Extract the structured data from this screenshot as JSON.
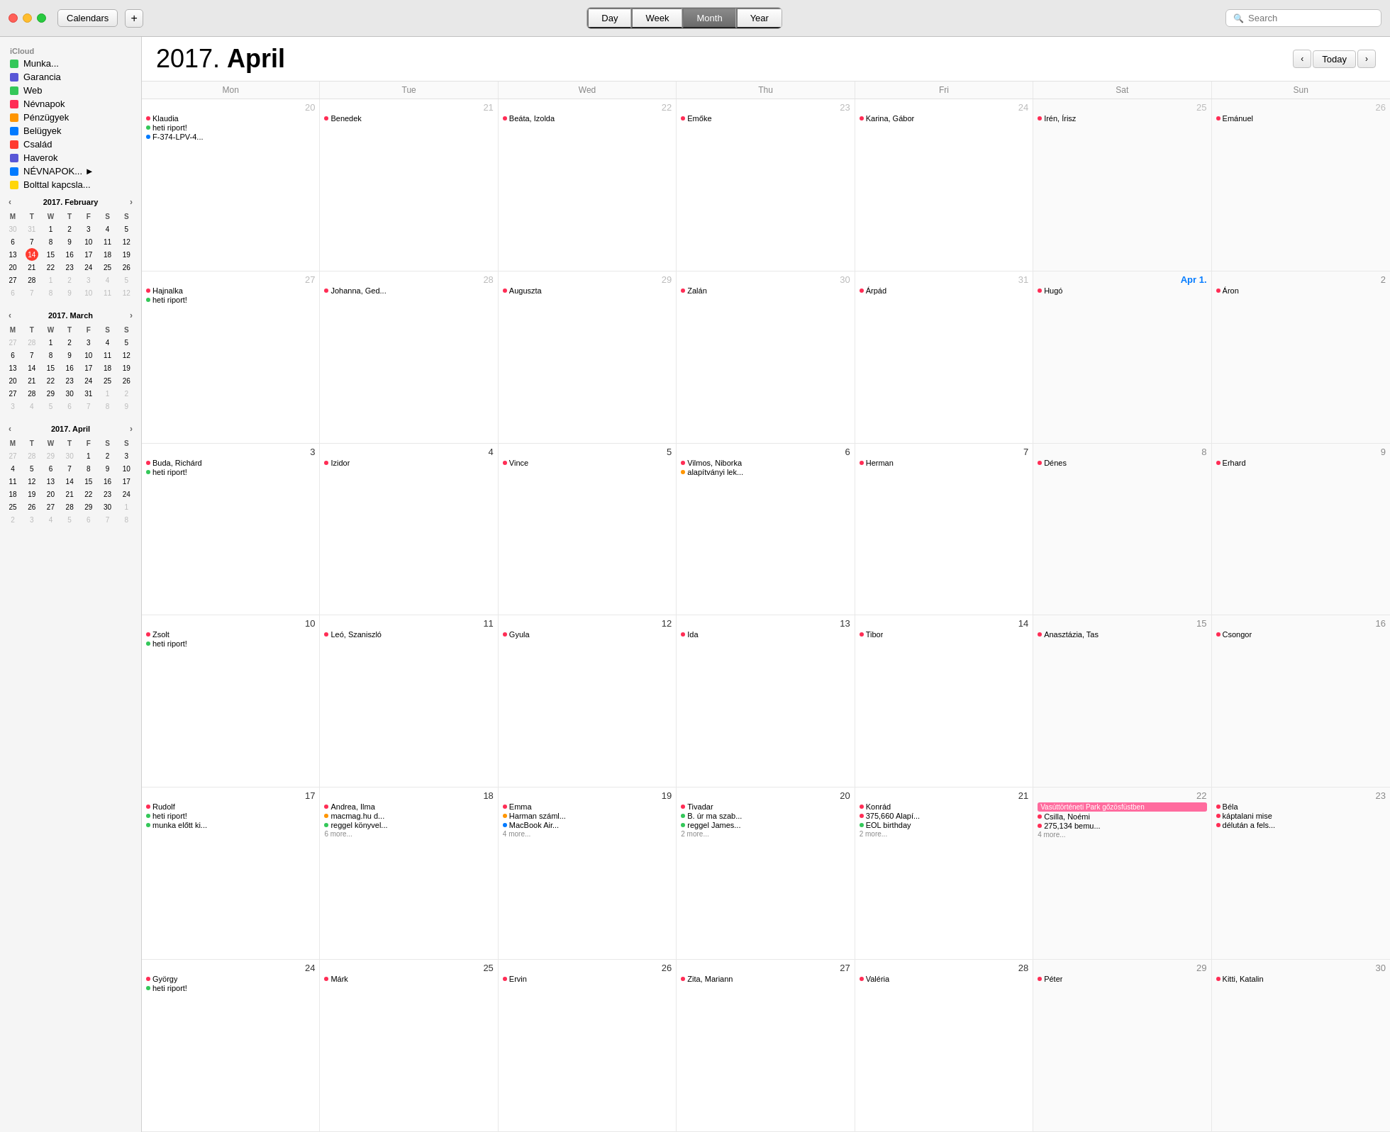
{
  "titlebar": {
    "calendars_label": "Calendars",
    "add_label": "+",
    "view_day": "Day",
    "view_week": "Week",
    "view_month": "Month",
    "view_year": "Year",
    "search_placeholder": "Search",
    "today_label": "Today"
  },
  "sidebar": {
    "section_label": "iCloud",
    "calendars": [
      {
        "name": "Munka...",
        "color": "#34c759",
        "checked": true
      },
      {
        "name": "Garancia",
        "color": "#5856d6",
        "checked": true
      },
      {
        "name": "Web",
        "color": "#34c759",
        "checked": true
      },
      {
        "name": "Névnapok",
        "color": "#ff2d55",
        "checked": true
      },
      {
        "name": "Pénzügyek",
        "color": "#ff9500",
        "checked": true
      },
      {
        "name": "Belügyek",
        "color": "#007aff",
        "checked": true
      },
      {
        "name": "Család",
        "color": "#ff3b30",
        "checked": true
      },
      {
        "name": "Haverok",
        "color": "#5856d6",
        "checked": true
      },
      {
        "name": "NÉVNAPOK... ►",
        "color": "#007aff",
        "checked": true
      },
      {
        "name": "Bolttal kapcsla...",
        "color": "#ffd60a",
        "checked": true
      }
    ]
  },
  "main_title": "2017. April",
  "day_headers": [
    "Mon",
    "Tue",
    "Wed",
    "Thu",
    "Fri",
    "Sat",
    "Sun"
  ],
  "weeks": [
    {
      "days": [
        {
          "num": "20",
          "gray": true,
          "events": [
            {
              "dot": "#ff2d55",
              "text": "Klaudia"
            },
            {
              "dot": "#34c759",
              "text": "heti riport!"
            },
            {
              "dot": "#007aff",
              "text": "F-374-LPV-4..."
            }
          ]
        },
        {
          "num": "21",
          "gray": true,
          "events": [
            {
              "dot": "#ff2d55",
              "text": "Benedek"
            }
          ]
        },
        {
          "num": "22",
          "gray": true,
          "events": [
            {
              "dot": "#ff2d55",
              "text": "Beáta, Izolda"
            }
          ]
        },
        {
          "num": "23",
          "gray": true,
          "events": [
            {
              "dot": "#ff2d55",
              "text": "Emőke"
            }
          ]
        },
        {
          "num": "24",
          "gray": true,
          "events": [
            {
              "dot": "#ff2d55",
              "text": "Karina, Gábor"
            }
          ]
        },
        {
          "num": "25",
          "gray": true,
          "sat": true,
          "events": [
            {
              "dot": "#ff2d55",
              "text": "Irén, Írisz"
            }
          ]
        },
        {
          "num": "26",
          "gray": true,
          "sun": true,
          "events": [
            {
              "dot": "#ff2d55",
              "text": "Emánuel"
            }
          ]
        }
      ]
    },
    {
      "days": [
        {
          "num": "27",
          "gray": true,
          "events": [
            {
              "dot": "#ff2d55",
              "text": "Hajnalka"
            },
            {
              "dot": "#34c759",
              "text": "heti riport!"
            }
          ]
        },
        {
          "num": "28",
          "gray": true,
          "events": [
            {
              "dot": "#ff2d55",
              "text": "Johanna, Ged..."
            }
          ]
        },
        {
          "num": "29",
          "gray": true,
          "events": [
            {
              "dot": "#ff2d55",
              "text": "Auguszta"
            }
          ]
        },
        {
          "num": "30",
          "gray": true,
          "events": [
            {
              "dot": "#ff2d55",
              "text": "Zalán"
            }
          ]
        },
        {
          "num": "31",
          "gray": true,
          "events": [
            {
              "dot": "#ff2d55",
              "text": "Árpád"
            }
          ]
        },
        {
          "num": "Apr 1.",
          "blue": true,
          "sat": true,
          "events": [
            {
              "dot": "#ff2d55",
              "text": "Hugó"
            }
          ]
        },
        {
          "num": "2",
          "sun": true,
          "events": [
            {
              "dot": "#ff2d55",
              "text": "Áron"
            }
          ]
        }
      ]
    },
    {
      "days": [
        {
          "num": "3",
          "events": [
            {
              "dot": "#ff2d55",
              "text": "Buda, Richárd"
            },
            {
              "dot": "#34c759",
              "text": "heti riport!"
            }
          ]
        },
        {
          "num": "4",
          "events": [
            {
              "dot": "#ff2d55",
              "text": "Izidor"
            }
          ]
        },
        {
          "num": "5",
          "events": [
            {
              "dot": "#ff2d55",
              "text": "Vince"
            }
          ]
        },
        {
          "num": "6",
          "events": [
            {
              "dot": "#ff2d55",
              "text": "Vilmos, Niborka"
            },
            {
              "dot": "#ff9500",
              "text": "alapítványi lek..."
            }
          ]
        },
        {
          "num": "7",
          "events": [
            {
              "dot": "#ff2d55",
              "text": "Herman"
            }
          ]
        },
        {
          "num": "8",
          "sat": true,
          "events": [
            {
              "dot": "#ff2d55",
              "text": "Dénes"
            }
          ]
        },
        {
          "num": "9",
          "sun": true,
          "events": [
            {
              "dot": "#ff2d55",
              "text": "Erhard"
            }
          ]
        }
      ]
    },
    {
      "days": [
        {
          "num": "10",
          "events": [
            {
              "dot": "#ff2d55",
              "text": "Zsolt"
            },
            {
              "dot": "#34c759",
              "text": "heti riport!"
            }
          ]
        },
        {
          "num": "11",
          "events": [
            {
              "dot": "#ff2d55",
              "text": "Leó, Szaniszló"
            }
          ]
        },
        {
          "num": "12",
          "events": [
            {
              "dot": "#ff2d55",
              "text": "Gyula"
            }
          ]
        },
        {
          "num": "13",
          "events": [
            {
              "dot": "#ff2d55",
              "text": "Ida"
            }
          ]
        },
        {
          "num": "14",
          "events": [
            {
              "dot": "#ff2d55",
              "text": "Tibor"
            }
          ]
        },
        {
          "num": "15",
          "sat": true,
          "events": [
            {
              "dot": "#ff2d55",
              "text": "Anasztázia, Tas"
            }
          ]
        },
        {
          "num": "16",
          "sun": true,
          "events": [
            {
              "dot": "#ff2d55",
              "text": "Csongor"
            }
          ]
        }
      ]
    },
    {
      "days": [
        {
          "num": "17",
          "events": [
            {
              "dot": "#ff2d55",
              "text": "Rudolf"
            },
            {
              "dot": "#34c759",
              "text": "heti riport!"
            },
            {
              "dot": "#34c759",
              "text": "munka előtt ki..."
            }
          ]
        },
        {
          "num": "18",
          "events": [
            {
              "dot": "#ff2d55",
              "text": "Andrea, Ilma"
            },
            {
              "dot": "#ff9500",
              "text": "macmag.hu d..."
            },
            {
              "dot": "#34c759",
              "text": "reggel könyvel..."
            },
            {
              "more": "6 more..."
            }
          ]
        },
        {
          "num": "19",
          "events": [
            {
              "dot": "#ff2d55",
              "text": "Emma"
            },
            {
              "dot": "#ff9500",
              "text": "Harman száml..."
            },
            {
              "dot": "#007aff",
              "text": "MacBook Air..."
            },
            {
              "more": "4 more..."
            }
          ]
        },
        {
          "num": "20",
          "events": [
            {
              "dot": "#ff2d55",
              "text": "Tivadar"
            },
            {
              "dot": "#34c759",
              "text": "B. úr ma szab..."
            },
            {
              "dot": "#34c759",
              "text": "reggel James..."
            },
            {
              "more": "2 more..."
            }
          ]
        },
        {
          "num": "21",
          "events": [
            {
              "dot": "#ff2d55",
              "text": "Konrád"
            },
            {
              "dot": "#ff2d55",
              "text": "375,660 Alapí..."
            },
            {
              "dot": "#34c759",
              "text": "EOL birthday"
            },
            {
              "more": "2 more..."
            }
          ]
        },
        {
          "num": "22",
          "sat": true,
          "banner": "Vasúttörténeti Park gőzösfüstben",
          "events": [
            {
              "dot": "#ff2d55",
              "text": "Csilla, Noémi"
            },
            {
              "dot": "#ff2d55",
              "text": "275,134 bemu..."
            },
            {
              "more": "4 more..."
            }
          ]
        },
        {
          "num": "23",
          "sun": true,
          "events": [
            {
              "dot": "#ff2d55",
              "text": "Béla"
            },
            {
              "dot": "#ff2d55",
              "text": "káptalani mise"
            },
            {
              "dot": "#ff2d55",
              "text": "délután a fels..."
            }
          ]
        }
      ]
    },
    {
      "days": [
        {
          "num": "24",
          "events": [
            {
              "dot": "#ff2d55",
              "text": "György"
            },
            {
              "dot": "#34c759",
              "text": "heti riport!"
            }
          ]
        },
        {
          "num": "25",
          "events": [
            {
              "dot": "#ff2d55",
              "text": "Márk"
            }
          ]
        },
        {
          "num": "26",
          "events": [
            {
              "dot": "#ff2d55",
              "text": "Ervin"
            }
          ]
        },
        {
          "num": "27",
          "events": [
            {
              "dot": "#ff2d55",
              "text": "Zita, Mariann"
            }
          ]
        },
        {
          "num": "28",
          "events": [
            {
              "dot": "#ff2d55",
              "text": "Valéria"
            }
          ]
        },
        {
          "num": "29",
          "sat": true,
          "events": [
            {
              "dot": "#ff2d55",
              "text": "Péter"
            }
          ]
        },
        {
          "num": "30",
          "sun": true,
          "events": [
            {
              "dot": "#ff2d55",
              "text": "Kitti, Katalin"
            }
          ]
        }
      ]
    }
  ],
  "mini_cals": [
    {
      "title": "2017. February",
      "headers": [
        "M",
        "T",
        "W",
        "T",
        "F",
        "S",
        "S"
      ],
      "weeks": [
        [
          "30",
          "31",
          "1",
          "2",
          "3",
          "4",
          "5"
        ],
        [
          "6",
          "7",
          "8",
          "9",
          "10",
          "11",
          "12"
        ],
        [
          "13",
          "14",
          "15",
          "16",
          "17",
          "18",
          "19"
        ],
        [
          "20",
          "21",
          "22",
          "23",
          "24",
          "25",
          "26"
        ],
        [
          "27",
          "28",
          "1",
          "2",
          "3",
          "4",
          "5"
        ],
        [
          "6",
          "7",
          "8",
          "9",
          "10",
          "11",
          "12"
        ]
      ],
      "today": "14",
      "other_start": [
        "30",
        "31"
      ],
      "other_end": [
        "1",
        "2",
        "3",
        "4",
        "5",
        "6",
        "7",
        "8",
        "9",
        "10",
        "11",
        "12"
      ]
    },
    {
      "title": "2017. March",
      "headers": [
        "M",
        "T",
        "W",
        "T",
        "F",
        "S",
        "S"
      ],
      "weeks": [
        [
          "27",
          "28",
          "1",
          "2",
          "3",
          "4",
          "5"
        ],
        [
          "6",
          "7",
          "8",
          "9",
          "10",
          "11",
          "12"
        ],
        [
          "13",
          "14",
          "15",
          "16",
          "17",
          "18",
          "19"
        ],
        [
          "20",
          "21",
          "22",
          "23",
          "24",
          "25",
          "26"
        ],
        [
          "27",
          "28",
          "29",
          "30",
          "31",
          "1",
          "2"
        ],
        [
          "3",
          "4",
          "5",
          "6",
          "7",
          "8",
          "9"
        ]
      ],
      "other_start": [
        "27",
        "28"
      ],
      "other_end": [
        "1",
        "2",
        "3",
        "4",
        "5",
        "6",
        "7",
        "8",
        "9"
      ]
    },
    {
      "title": "2017. April",
      "headers": [
        "M",
        "T",
        "W",
        "T",
        "F",
        "S",
        "S"
      ],
      "weeks": [
        [
          "27",
          "28",
          "29",
          "30",
          "1",
          "2",
          "3"
        ],
        [
          "4",
          "5",
          "6",
          "7",
          "8",
          "9",
          "10"
        ],
        [
          "11",
          "12",
          "13",
          "14",
          "15",
          "16",
          "17"
        ],
        [
          "18",
          "19",
          "20",
          "21",
          "22",
          "23",
          "24"
        ],
        [
          "25",
          "26",
          "27",
          "28",
          "29",
          "30",
          "1"
        ],
        [
          "2",
          "3",
          "4",
          "5",
          "6",
          "7",
          "8"
        ]
      ],
      "other_start": [
        "27",
        "28",
        "29",
        "30"
      ],
      "other_end": [
        "1",
        "2",
        "3",
        "4",
        "5",
        "6",
        "7",
        "8"
      ]
    }
  ]
}
